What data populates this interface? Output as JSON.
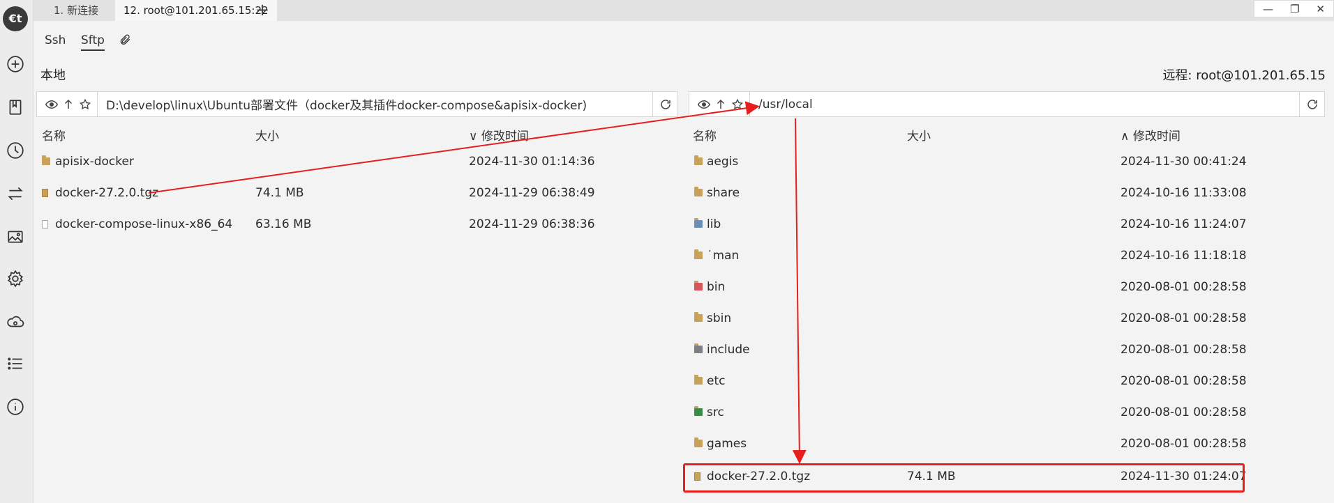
{
  "tabs": [
    {
      "label": "1. 新连接",
      "active": false
    },
    {
      "label": "12. root@101.201.65.15:22",
      "active": true
    }
  ],
  "window_controls": [
    "—",
    "❐",
    "✕"
  ],
  "protocols": {
    "ssh": "Ssh",
    "sftp": "Sftp"
  },
  "local": {
    "label": "本地",
    "path": "D:\\develop\\linux\\Ubuntu部署文件（docker及其插件docker-compose&apisix-docker)",
    "columns": {
      "name": "名称",
      "size": "大小",
      "mtime": "修改时间"
    },
    "files": [
      {
        "name": "apisix-docker",
        "size": "",
        "mtime": "2024-11-30 01:14:36",
        "icon": "folder-icon"
      },
      {
        "name": "docker-27.2.0.tgz",
        "size": "74.1 MB",
        "mtime": "2024-11-29 06:38:49",
        "icon": "archive-icon"
      },
      {
        "name": "docker-compose-linux-x86_64",
        "size": "63.16 MB",
        "mtime": "2024-11-29 06:38:36",
        "icon": "file-icon"
      }
    ]
  },
  "remote": {
    "label": "远程: root@101.201.65.15",
    "path": "/usr/local",
    "columns": {
      "name": "名称",
      "size": "大小",
      "mtime": "修改时间"
    },
    "files": [
      {
        "name": "aegis",
        "size": "",
        "mtime": "2024-11-30 00:41:24",
        "icon": "folder-icon"
      },
      {
        "name": "share",
        "size": "",
        "mtime": "2024-10-16 11:33:08",
        "icon": "folder-icon"
      },
      {
        "name": "lib",
        "size": "",
        "mtime": "2024-10-16 11:24:07",
        "icon": "lib-folder-icon"
      },
      {
        "name": "man",
        "size": "",
        "mtime": "2024-10-16 11:18:18",
        "icon": "link-folder-icon"
      },
      {
        "name": "bin",
        "size": "",
        "mtime": "2020-08-01 00:28:58",
        "icon": "bin-folder-icon"
      },
      {
        "name": "sbin",
        "size": "",
        "mtime": "2020-08-01 00:28:58",
        "icon": "folder-icon"
      },
      {
        "name": "include",
        "size": "",
        "mtime": "2020-08-01 00:28:58",
        "icon": "include-folder-icon"
      },
      {
        "name": "etc",
        "size": "",
        "mtime": "2020-08-01 00:28:58",
        "icon": "folder-icon"
      },
      {
        "name": "src",
        "size": "",
        "mtime": "2020-08-01 00:28:58",
        "icon": "src-folder-icon"
      },
      {
        "name": "games",
        "size": "",
        "mtime": "2020-08-01 00:28:58",
        "icon": "folder-icon"
      },
      {
        "name": "docker-27.2.0.tgz",
        "size": "74.1 MB",
        "mtime": "2024-11-30 01:24:07",
        "icon": "archive-icon"
      }
    ]
  },
  "annotation_color": "#e81e1e"
}
